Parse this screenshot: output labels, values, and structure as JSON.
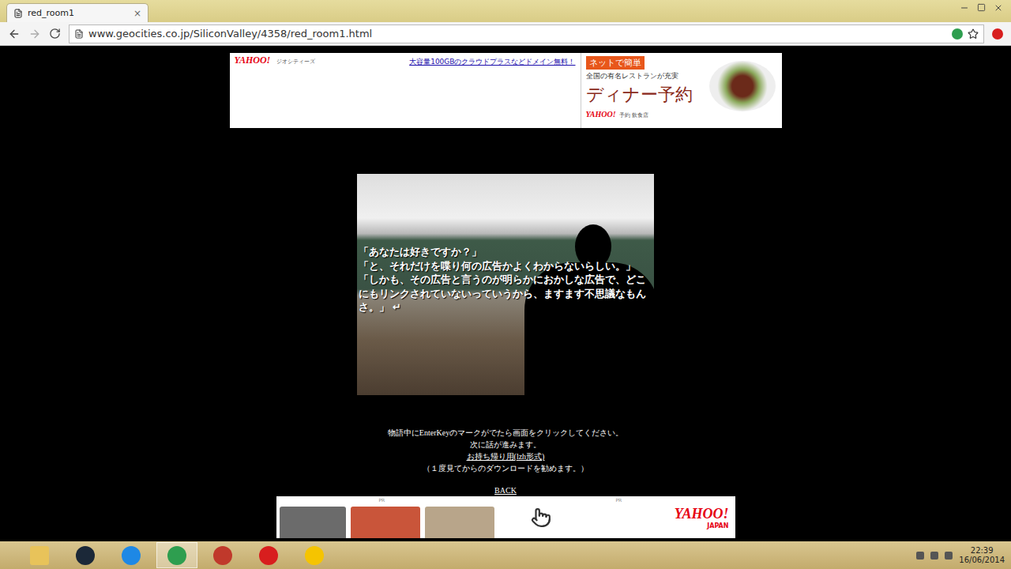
{
  "browser": {
    "tab": {
      "title": "red_room1",
      "close": "×"
    },
    "url": "www.geocities.co.jp/SiliconValley/4358/red_room1.html"
  },
  "top_ad": {
    "logo": "YAHOO!",
    "label": "ジオシティーズ",
    "link": "大容量100GBのクラウドプラスなどドメイン無料！",
    "badge": "ネットで簡単",
    "tagline": "全国の有名レストランが充実",
    "headline": "ディナー予約",
    "footer_logo": "YAHOO!",
    "footer_text": "予約 飲食店"
  },
  "story": {
    "dialogue": [
      "「あなたは好きですか？」",
      "「と、それだけを喋り何の広告かよくわからないらしい。」",
      "「しかも、その広告と言うのが明らかにおかしな広告で、どこにもリンクされていないっていうから、ますます不思議なもんさ。」"
    ],
    "enter_mark": "↵"
  },
  "instructions": [
    "物語中にEnterKeyのマークがでたら画面をクリックしてください。",
    "次に話が進みます。"
  ],
  "download": {
    "link": "お持ち帰り用(lzh形式)",
    "note": "（１度見てからのダウンロードを勧めます。）"
  },
  "back": "BACK",
  "bottom_ad": {
    "pr": [
      "PR",
      "PR"
    ],
    "logo": "YAHOO!",
    "sub": "JAPAN"
  },
  "taskbar": {
    "apps": [
      {
        "kind": "folder",
        "color": "#e8c35a",
        "selected": false
      },
      {
        "kind": "steam",
        "color": "#1b2838",
        "selected": false
      },
      {
        "kind": "ie",
        "color": "#1e88e5",
        "selected": false
      },
      {
        "kind": "chrome",
        "color": "#2e9e4f",
        "selected": true
      },
      {
        "kind": "app",
        "color": "#c0392b",
        "selected": false
      },
      {
        "kind": "app",
        "color": "#d81e1e",
        "selected": false
      },
      {
        "kind": "app",
        "color": "#f5c400",
        "selected": false
      }
    ],
    "time": "22:39",
    "date": "16/06/2014"
  }
}
